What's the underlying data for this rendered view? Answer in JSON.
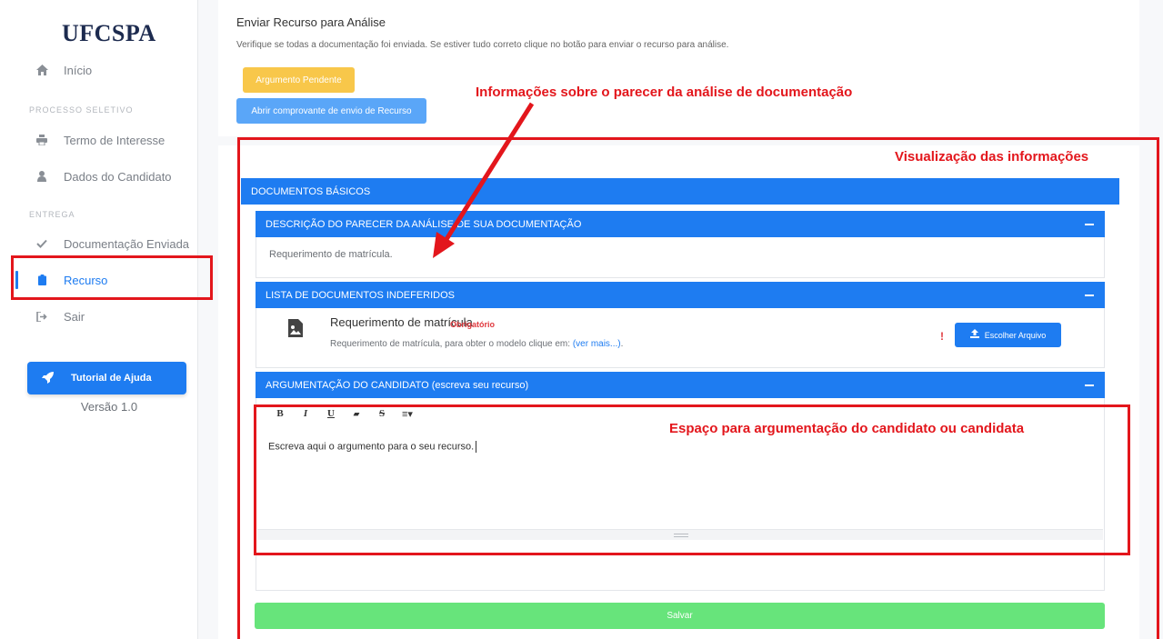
{
  "sidebar": {
    "logo": "UFCSPA",
    "items": [
      {
        "label": "Início",
        "icon": "home-icon"
      },
      {
        "label": "Termo de Interesse",
        "icon": "print-icon"
      },
      {
        "label": "Dados do Candidato",
        "icon": "user-icon"
      },
      {
        "label": "Documentação Enviada",
        "icon": "check-icon"
      },
      {
        "label": "Recurso",
        "icon": "clipboard-icon"
      },
      {
        "label": "Sair",
        "icon": "sign-out-icon"
      }
    ],
    "sections": {
      "processo": "PROCESSO SELETIVO",
      "entrega": "ENTREGA"
    },
    "help_button": "Tutorial de Ajuda",
    "version": "Versão 1.0"
  },
  "top": {
    "title": "Enviar Recurso para Análise",
    "description": "Verifique se todas a documentação foi enviada. Se estiver tudo correto clique no botão para enviar o recurso para análise.",
    "pending_button": "Argumento Pendente",
    "receipt_button": "Abrir comprovante de envio de Recurso"
  },
  "main": {
    "docs_header": "DOCUMENTOS BÁSICOS",
    "parecer_header": "DESCRIÇÃO DO PARECER DA ANÁLISE DE SUA DOCUMENTAÇÃO",
    "parecer_text": "Requerimento de matrícula.",
    "indeferidos_header": "LISTA DE DOCUMENTOS INDEFERIDOS",
    "doc_title": "Requerimento de matrícula",
    "doc_required": "Obrigatório",
    "doc_desc": "Requerimento de matrícula, para obter o modelo clique em: ",
    "doc_link": "(ver mais...)",
    "doc_desc_end": ".",
    "file_button": "Escolher Arquivo",
    "excl": "!",
    "argument_header": "ARGUMENTAÇÃO DO CANDIDATO (escreva seu recurso)",
    "toolbar": {
      "bold": "B",
      "italic": "I",
      "underline": "U",
      "eraser": "▰",
      "strike": "S",
      "align": "≡▾"
    },
    "editor_text": "Escreva aqui o argumento para o seu recurso.",
    "save_button": "Salvar"
  },
  "annotations": {
    "parecer": "Informações sobre o parecer da análise de documentação",
    "visualizacao": "Visualização das informações",
    "espaco": "Espaço para argumentação do candidato ou candidata"
  },
  "colors": {
    "primary": "#1e7cf1",
    "warning": "#f8c74a",
    "success": "#67e47b",
    "annotation": "#e3161c"
  }
}
